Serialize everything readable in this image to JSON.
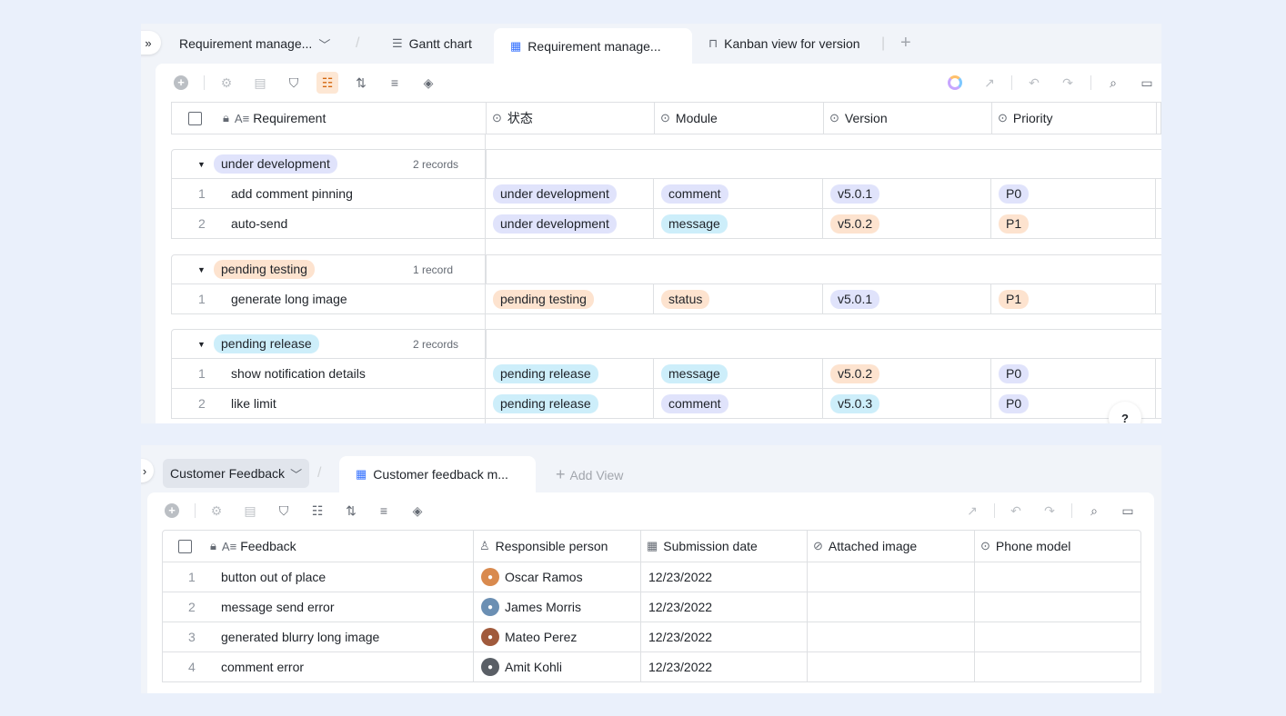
{
  "top": {
    "breadcrumb": "Requirement manage...",
    "tabs": [
      {
        "label": "Gantt chart",
        "icon": "gantt-icon"
      },
      {
        "label": "Requirement manage...",
        "icon": "grid-table-icon"
      },
      {
        "label": "Kanban view for version",
        "icon": "kanban-icon"
      }
    ],
    "columns": [
      "Requirement",
      "状态",
      "Module",
      "Version",
      "Priority"
    ],
    "groups": [
      {
        "name": "under development",
        "count": "2 records",
        "rows": [
          {
            "num": "1",
            "req": "add comment pinning",
            "status": "under development",
            "module": "comment",
            "version": "v5.0.1",
            "priority": "P0"
          },
          {
            "num": "2",
            "req": "auto-send",
            "status": "under development",
            "module": "message",
            "version": "v5.0.2",
            "priority": "P1"
          }
        ]
      },
      {
        "name": "pending testing",
        "count": "1 record",
        "rows": [
          {
            "num": "1",
            "req": "generate long image",
            "status": "pending testing",
            "module": "status",
            "version": "v5.0.1",
            "priority": "P1"
          }
        ]
      },
      {
        "name": "pending release",
        "count": "2 records",
        "rows": [
          {
            "num": "1",
            "req": "show notification details",
            "status": "pending release",
            "module": "message",
            "version": "v5.0.2",
            "priority": "P0"
          },
          {
            "num": "2",
            "req": "like limit",
            "status": "pending release",
            "module": "comment",
            "version": "v5.0.3",
            "priority": "P0"
          }
        ]
      }
    ],
    "help": "?"
  },
  "bottom": {
    "dropdown": "Customer Feedback",
    "tab": "Customer feedback m...",
    "add_view": "Add View",
    "columns": [
      "Feedback",
      "Responsible person",
      "Submission date",
      "Attached image",
      "Phone model"
    ],
    "rows": [
      {
        "num": "1",
        "feedback": "button out of place",
        "person": "Oscar Ramos",
        "date": "12/23/2022"
      },
      {
        "num": "2",
        "feedback": "message send error",
        "person": "James Morris",
        "date": "12/23/2022"
      },
      {
        "num": "3",
        "feedback": "generated blurry long image",
        "person": "Mateo Perez",
        "date": "12/23/2022"
      },
      {
        "num": "4",
        "feedback": "comment error",
        "person": "Amit Kohli",
        "date": "12/23/2022"
      }
    ]
  },
  "colors": {
    "status": {
      "under development": "#e0e3fb",
      "pending testing": "#fde3cf",
      "pending release": "#cdeefa"
    },
    "module": {
      "comment": "#e0e3fb",
      "message": "#cdeefa",
      "status": "#fde3cf"
    },
    "version": {
      "v5.0.1": "#e0e3fb",
      "v5.0.2": "#fde3cf",
      "v5.0.3": "#cdeefa"
    },
    "priority": {
      "P0": "#e0e3fb",
      "P1": "#fde3cf"
    },
    "avatars": [
      "#d98a4e",
      "#6b8fb3",
      "#a05a3c",
      "#5a5f66"
    ]
  }
}
